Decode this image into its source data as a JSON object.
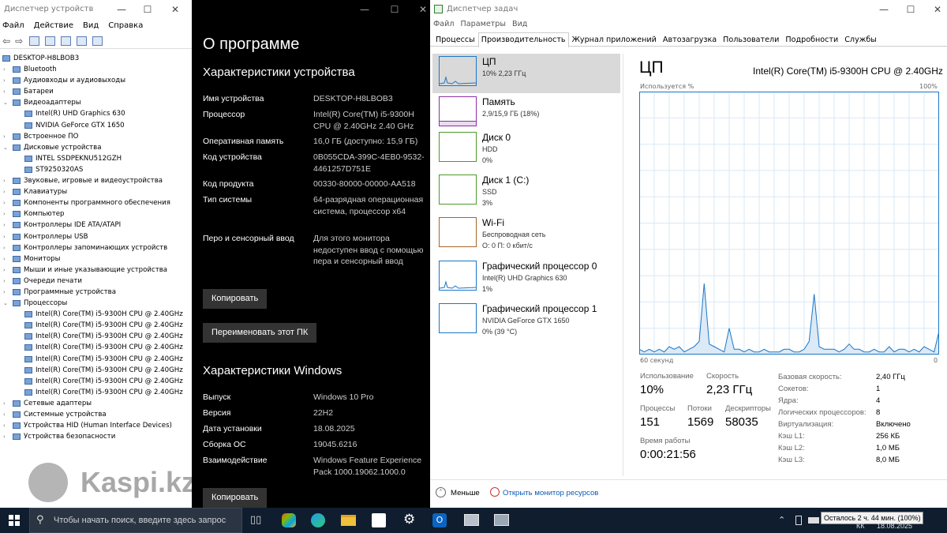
{
  "devmgr": {
    "title": "Диспетчер устройств",
    "menu": [
      "Файл",
      "Действие",
      "Вид",
      "Справка"
    ],
    "tree": [
      {
        "level": 0,
        "exp": "v",
        "label": "DESKTOP-H8LBOB3"
      },
      {
        "level": 1,
        "exp": ">",
        "label": "Bluetooth"
      },
      {
        "level": 1,
        "exp": ">",
        "label": "Аудиовходы и аудиовыходы"
      },
      {
        "level": 1,
        "exp": ">",
        "label": "Батареи"
      },
      {
        "level": 1,
        "exp": "v",
        "label": "Видеоадаптеры"
      },
      {
        "level": 2,
        "exp": "",
        "label": "Intel(R) UHD Graphics 630"
      },
      {
        "level": 2,
        "exp": "",
        "label": "NVIDIA GeForce GTX 1650"
      },
      {
        "level": 1,
        "exp": ">",
        "label": "Встроенное ПО"
      },
      {
        "level": 1,
        "exp": "v",
        "label": "Дисковые устройства"
      },
      {
        "level": 2,
        "exp": "",
        "label": "INTEL SSDPEKNU512GZH"
      },
      {
        "level": 2,
        "exp": "",
        "label": "ST9250320AS"
      },
      {
        "level": 1,
        "exp": ">",
        "label": "Звуковые, игровые и видеоустройства"
      },
      {
        "level": 1,
        "exp": ">",
        "label": "Клавиатуры"
      },
      {
        "level": 1,
        "exp": ">",
        "label": "Компоненты программного обеспечения"
      },
      {
        "level": 1,
        "exp": ">",
        "label": "Компьютер"
      },
      {
        "level": 1,
        "exp": ">",
        "label": "Контроллеры IDE ATA/ATAPI"
      },
      {
        "level": 1,
        "exp": ">",
        "label": "Контроллеры USB"
      },
      {
        "level": 1,
        "exp": ">",
        "label": "Контроллеры запоминающих устройств"
      },
      {
        "level": 1,
        "exp": ">",
        "label": "Мониторы"
      },
      {
        "level": 1,
        "exp": ">",
        "label": "Мыши и иные указывающие устройства"
      },
      {
        "level": 1,
        "exp": ">",
        "label": "Очереди печати"
      },
      {
        "level": 1,
        "exp": ">",
        "label": "Программные устройства"
      },
      {
        "level": 1,
        "exp": "v",
        "label": "Процессоры"
      },
      {
        "level": 2,
        "exp": "",
        "label": "Intel(R) Core(TM) i5-9300H CPU @ 2.40GHz"
      },
      {
        "level": 2,
        "exp": "",
        "label": "Intel(R) Core(TM) i5-9300H CPU @ 2.40GHz"
      },
      {
        "level": 2,
        "exp": "",
        "label": "Intel(R) Core(TM) i5-9300H CPU @ 2.40GHz"
      },
      {
        "level": 2,
        "exp": "",
        "label": "Intel(R) Core(TM) i5-9300H CPU @ 2.40GHz"
      },
      {
        "level": 2,
        "exp": "",
        "label": "Intel(R) Core(TM) i5-9300H CPU @ 2.40GHz"
      },
      {
        "level": 2,
        "exp": "",
        "label": "Intel(R) Core(TM) i5-9300H CPU @ 2.40GHz"
      },
      {
        "level": 2,
        "exp": "",
        "label": "Intel(R) Core(TM) i5-9300H CPU @ 2.40GHz"
      },
      {
        "level": 2,
        "exp": "",
        "label": "Intel(R) Core(TM) i5-9300H CPU @ 2.40GHz"
      },
      {
        "level": 1,
        "exp": ">",
        "label": "Сетевые адаптеры"
      },
      {
        "level": 1,
        "exp": ">",
        "label": "Системные устройства"
      },
      {
        "level": 1,
        "exp": ">",
        "label": "Устройства HID (Human Interface Devices)"
      },
      {
        "level": 1,
        "exp": ">",
        "label": "Устройства безопасности"
      }
    ]
  },
  "watermark": "Kaspi.kz",
  "about": {
    "title": "О программе",
    "device_heading": "Характеристики устройства",
    "device_specs": [
      {
        "k": "Имя устройства",
        "v": "DESKTOP-H8LBOB3"
      },
      {
        "k": "Процессор",
        "v": "Intel(R) Core(TM) i5-9300H CPU @ 2.40GHz   2.40 GHz"
      },
      {
        "k": "Оперативная память",
        "v": "16,0 ГБ (доступно: 15,9 ГБ)"
      },
      {
        "k": "Код устройства",
        "v": "0B055CDA-399C-4EB0-9532-4461257D751E"
      },
      {
        "k": "Код продукта",
        "v": "00330-80000-00000-AA518"
      },
      {
        "k": "Тип системы",
        "v": "64-разрядная операционная система, процессор x64"
      },
      {
        "k": "Перо и сенсорный ввод",
        "v": "Для этого монитора недоступен ввод с помощью пера и сенсорный ввод"
      }
    ],
    "copy_label": "Копировать",
    "rename_label": "Переименовать этот ПК",
    "windows_heading": "Характеристики Windows",
    "windows_specs": [
      {
        "k": "Выпуск",
        "v": "Windows 10 Pro"
      },
      {
        "k": "Версия",
        "v": "22H2"
      },
      {
        "k": "Дата установки",
        "v": "18.08.2025"
      },
      {
        "k": "Сборка ОС",
        "v": "19045.6216"
      },
      {
        "k": "Взаимодействие",
        "v": "Windows Feature Experience Pack 1000.19062.1000.0"
      }
    ],
    "copy_label2": "Копировать"
  },
  "taskmgr": {
    "title": "Диспетчер задач",
    "menu": [
      "Файл",
      "Параметры",
      "Вид"
    ],
    "tabs": [
      "Процессы",
      "Производительность",
      "Журнал приложений",
      "Автозагрузка",
      "Пользователи",
      "Подробности",
      "Службы"
    ],
    "active_tab": 1,
    "resources": [
      {
        "name": "ЦП",
        "sub1": "10% 2,23 ГГц",
        "sub2": "",
        "color": "#1c76c7"
      },
      {
        "name": "Память",
        "sub1": "2,9/15,9 ГБ (18%)",
        "sub2": "",
        "color": "#8b2fa8"
      },
      {
        "name": "Диск 0",
        "sub1": "HDD",
        "sub2": "0%",
        "color": "#4c9a2a"
      },
      {
        "name": "Диск 1 (C:)",
        "sub1": "SSD",
        "sub2": "3%",
        "color": "#4c9a2a"
      },
      {
        "name": "Wi-Fi",
        "sub1": "Беспроводная сеть",
        "sub2": "О: 0 П: 0 кбит/с",
        "color": "#a7652a"
      },
      {
        "name": "Графический процессор 0",
        "sub1": "Intel(R) UHD Graphics 630",
        "sub2": "1%",
        "color": "#1c76c7"
      },
      {
        "name": "Графический процессор 1",
        "sub1": "NVIDIA GeForce GTX 1650",
        "sub2": "0% (39 °C)",
        "color": "#1c76c7"
      }
    ],
    "cpu_title": "ЦП",
    "cpu_model": "Intel(R) Core(TM) i5-9300H CPU @ 2.40GHz",
    "graph_label_left": "Используется %",
    "graph_label_right": "100%",
    "graph_bottom_left": "60 секунд",
    "graph_bottom_right": "0",
    "cpu_usage_history": [
      2,
      1,
      2,
      1,
      2,
      1,
      3,
      2,
      3,
      1,
      2,
      3,
      5,
      27,
      4,
      3,
      2,
      1,
      10,
      2,
      2,
      1,
      2,
      1,
      1,
      2,
      1,
      1,
      1,
      2,
      2,
      1,
      1,
      2,
      5,
      23,
      3,
      2,
      2,
      2,
      1,
      2,
      4,
      2,
      2,
      1,
      1,
      2,
      1,
      1,
      3,
      1,
      2,
      2,
      1,
      2,
      1,
      3,
      2,
      1,
      9
    ],
    "stats": {
      "usage_label": "Использование",
      "usage": "10%",
      "speed_label": "Скорость",
      "speed": "2,23 ГГц",
      "proc_label": "Процессы",
      "proc": "151",
      "threads_label": "Потоки",
      "threads": "1569",
      "handles_label": "Дескрипторы",
      "handles": "58035",
      "uptime_label": "Время работы",
      "uptime": "0:00:21:56"
    },
    "details": [
      {
        "k": "Базовая скорость:",
        "v": "2,40 ГГц"
      },
      {
        "k": "Сокетов:",
        "v": "1"
      },
      {
        "k": "Ядра:",
        "v": "4"
      },
      {
        "k": "Логических процессоров:",
        "v": "8"
      },
      {
        "k": "Виртуализация:",
        "v": "Включено"
      },
      {
        "k": "Кэш L1:",
        "v": "256 КБ"
      },
      {
        "k": "Кэш L2:",
        "v": "1,0 МБ"
      },
      {
        "k": "Кэш L3:",
        "v": "8,0 МБ"
      }
    ],
    "less_label": "Меньше",
    "monitor_link": "Открыть монитор ресурсов"
  },
  "taskbar": {
    "search_placeholder": "Чтобы начать поиск, введите здесь запрос",
    "battery_tooltip": "Осталось 2 ч. 44 мин. (100%)",
    "lang": "КК",
    "date": "18.08.2025"
  }
}
